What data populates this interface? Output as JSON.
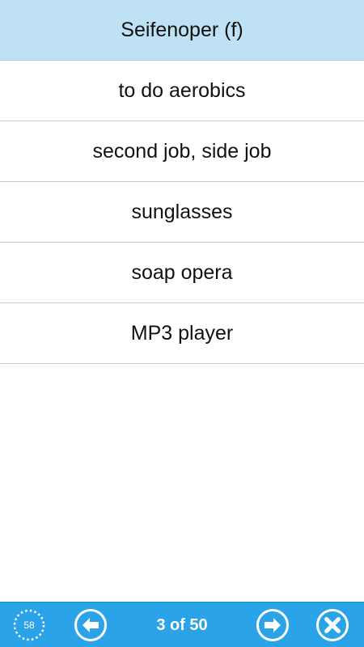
{
  "question": {
    "text": "Seifenoper (f)"
  },
  "answers": [
    {
      "label": "to do aerobics"
    },
    {
      "label": "second job, side job"
    },
    {
      "label": "sunglasses"
    },
    {
      "label": "soap opera"
    },
    {
      "label": "MP3 player"
    }
  ],
  "toolbar": {
    "timer_value": "58",
    "page_indicator": "3 of 50",
    "icons": {
      "timer": "timer-icon",
      "prev": "arrow-left-icon",
      "next": "arrow-right-icon",
      "close": "close-icon"
    }
  },
  "colors": {
    "question_bg": "#bfe1f4",
    "toolbar_bg": "#2aa3e8",
    "divider": "#c8c8c8"
  }
}
